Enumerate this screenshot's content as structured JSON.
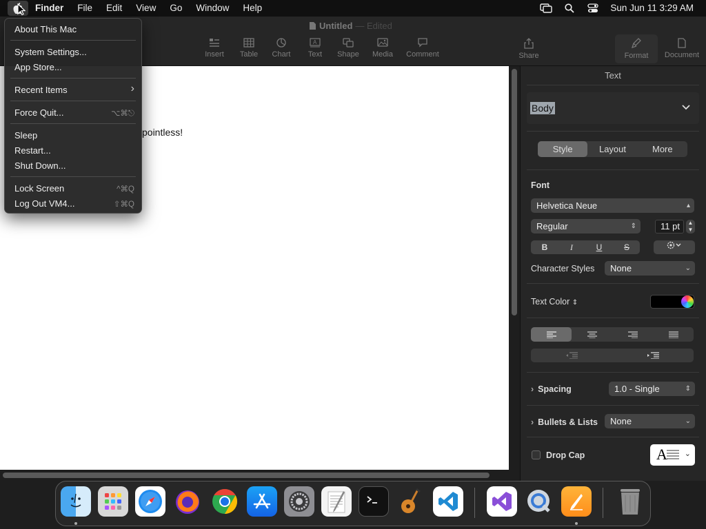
{
  "menubar": {
    "app": "Finder",
    "menus": [
      "File",
      "Edit",
      "View",
      "Go",
      "Window",
      "Help"
    ],
    "datetime": "Sun Jun 11  3:29 AM",
    "status_icons": [
      "screen-mirroring-icon",
      "spotlight-icon",
      "control-center-icon"
    ]
  },
  "window": {
    "title": "Untitled",
    "title_suffix": "— Edited",
    "toolbar": [
      {
        "label": "Insert",
        "icon": "insert-icon"
      },
      {
        "label": "Table",
        "icon": "table-icon"
      },
      {
        "label": "Chart",
        "icon": "chart-icon"
      },
      {
        "label": "Text",
        "icon": "text-box-icon"
      },
      {
        "label": "Shape",
        "icon": "shape-icon"
      },
      {
        "label": "Media",
        "icon": "media-icon"
      },
      {
        "label": "Comment",
        "icon": "comment-icon"
      },
      {
        "label": "Share",
        "icon": "share-icon"
      },
      {
        "label": "Format",
        "icon": "format-brush-icon"
      },
      {
        "label": "Document",
        "icon": "document-icon"
      }
    ]
  },
  "document": {
    "visible_text": "pointless!"
  },
  "inspector": {
    "title": "Text",
    "paragraph_style": "Body",
    "tabs": [
      "Style",
      "Layout",
      "More"
    ],
    "active_tab": "Style",
    "font_label": "Font",
    "font_family": "Helvetica Neue",
    "font_weight": "Regular",
    "font_size": "11 pt",
    "format_buttons": [
      "B",
      "I",
      "U",
      "S"
    ],
    "character_styles_label": "Character Styles",
    "character_styles_value": "None",
    "text_color_label": "Text Color",
    "text_color": "#000000",
    "alignment": [
      "left",
      "center",
      "right",
      "justify"
    ],
    "active_alignment": "left",
    "spacing_label": "Spacing",
    "spacing_value": "1.0 - Single",
    "bullets_label": "Bullets & Lists",
    "bullets_value": "None",
    "drop_cap_label": "Drop Cap",
    "drop_cap_preview": "A"
  },
  "apple_menu": {
    "items": [
      {
        "label": "About This Mac",
        "shortcut": ""
      },
      {
        "label": "System Settings...",
        "shortcut": ""
      },
      {
        "label": "App Store...",
        "shortcut": ""
      },
      {
        "label": "Recent Items",
        "shortcut": "›"
      },
      {
        "label": "Force Quit...",
        "shortcut": "⌥⌘⎋"
      },
      {
        "label": "Sleep",
        "shortcut": ""
      },
      {
        "label": "Restart...",
        "shortcut": ""
      },
      {
        "label": "Shut Down...",
        "shortcut": ""
      },
      {
        "label": "Lock Screen",
        "shortcut": "^⌘Q"
      },
      {
        "label": "Log Out VM4...",
        "shortcut": "⇧⌘Q"
      }
    ]
  },
  "dock": {
    "apps": [
      "Finder",
      "Launchpad",
      "Safari",
      "Firefox",
      "Chrome",
      "App Store",
      "System Settings",
      "TextEdit",
      "Terminal",
      "GarageBand",
      "Visual Studio Code",
      "Visual Studio",
      "QuickTime Player",
      "Pages",
      "Trash"
    ]
  }
}
